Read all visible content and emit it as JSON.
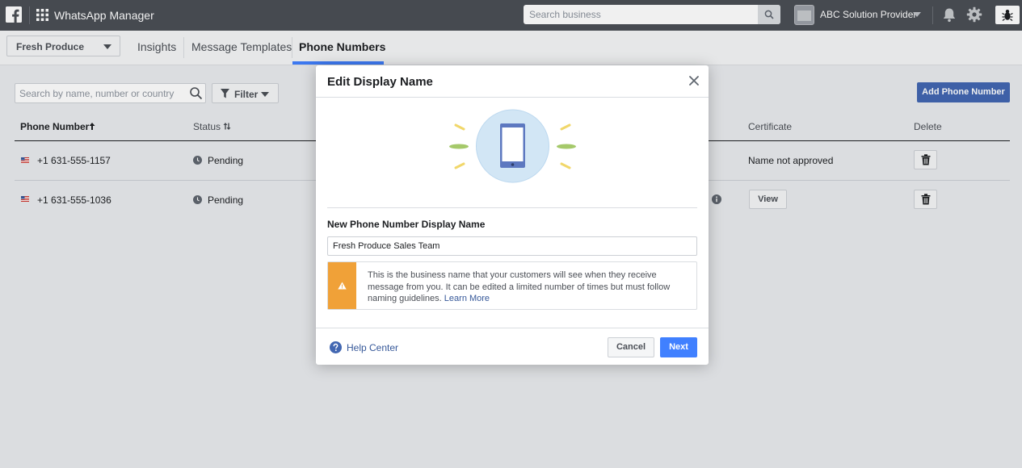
{
  "topbar": {
    "app_title": "WhatsApp Manager",
    "search_placeholder": "Search business",
    "business_name": "ABC Solution Provider",
    "icons": [
      "facebook-logo-icon",
      "apps-grid-icon",
      "search-icon",
      "bell-icon",
      "gear-icon",
      "bug-icon"
    ]
  },
  "subnav": {
    "account": "Fresh Produce",
    "tabs": [
      {
        "label": "Insights"
      },
      {
        "label": "Message Templates"
      },
      {
        "label": "Phone Numbers",
        "active": true
      }
    ]
  },
  "toolbar": {
    "search_placeholder": "Search by name, number or country",
    "filter_label": "Filter",
    "add_label": "Add Phone Number"
  },
  "table": {
    "headers": {
      "phone": "Phone Number",
      "status": "Status",
      "certificate": "Certificate",
      "delete": "Delete"
    },
    "rows": [
      {
        "phone": "+1 631-555-1157",
        "status": "Pending",
        "certificate": "Name not approved"
      },
      {
        "phone": "+1 631-555-1036",
        "status": "Pending",
        "certificate_button": "View"
      }
    ]
  },
  "modal": {
    "title": "Edit Display Name",
    "field_label": "New Phone Number Display Name",
    "field_value": "Fresh Produce Sales Team",
    "warning_text": "This is the business name that your customers will see when they receive message from you. It can be edited a limited number of times but must follow naming guidelines.",
    "warning_link": "Learn More",
    "help_link": "Help Center",
    "cancel_label": "Cancel",
    "next_label": "Next"
  },
  "colors": {
    "topbar": "#4b4f56",
    "accent": "#4080ff",
    "primary_button": "#4267b2",
    "warning": "#f0a138",
    "link": "#365899"
  }
}
